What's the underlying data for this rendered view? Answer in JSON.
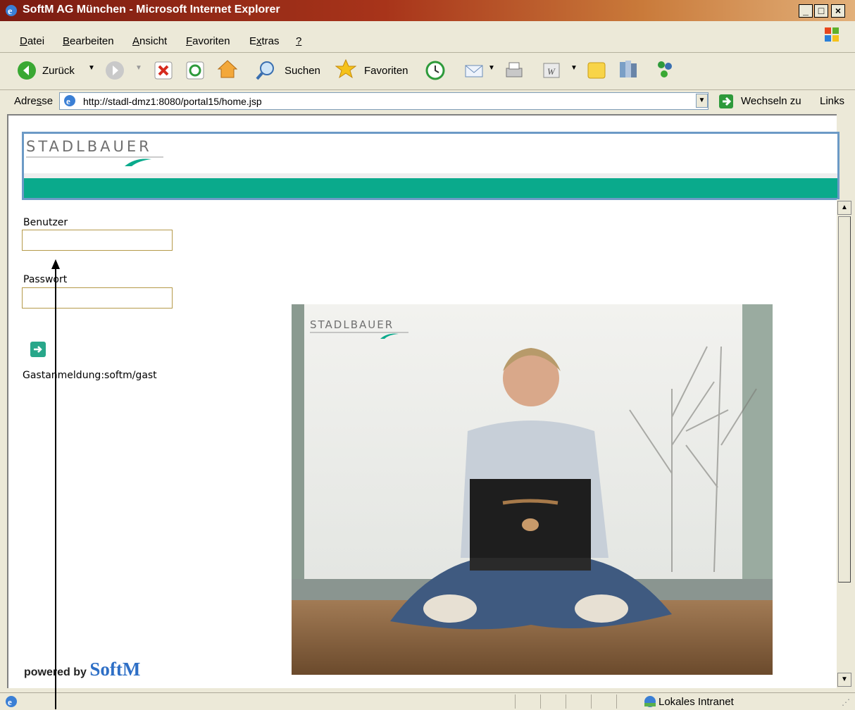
{
  "window": {
    "title": "SoftM AG München - Microsoft Internet Explorer",
    "minimize": "_",
    "maximize": "□",
    "close": "×"
  },
  "menu": {
    "items": [
      {
        "key": "D",
        "rest": "atei"
      },
      {
        "key": "B",
        "rest": "earbeiten"
      },
      {
        "key": "A",
        "rest": "nsicht"
      },
      {
        "key": "F",
        "rest": "avoriten"
      },
      {
        "pre": "E",
        "key": "x",
        "rest": "tras"
      },
      {
        "key": "?",
        "rest": ""
      }
    ]
  },
  "toolbar": {
    "back_label": "Zurück",
    "search_label": "Suchen",
    "favorites_label": "Favoriten"
  },
  "address": {
    "label_pre": "Adre",
    "label_key": "s",
    "label_post": "se",
    "url": "http://stadl-dmz1:8080/portal15/home.jsp",
    "go_label": "Wechseln zu",
    "links_label": "Links"
  },
  "page": {
    "logo_text": "STADLBAUER",
    "user_label": "Benutzer",
    "user_value": "",
    "password_label": "Passwort",
    "password_value": "",
    "guest_login": "Gastanmeldung:softm/gast",
    "powered_by": "powered by",
    "powered_brand": "SoftM",
    "photo_logo": "STADLBAUER"
  },
  "status": {
    "zone": "Lokales Intranet"
  },
  "colors": {
    "banner_strip": "#0aaa8c",
    "banner_border": "#6c9ac6",
    "titlebar": "#a8341a"
  }
}
